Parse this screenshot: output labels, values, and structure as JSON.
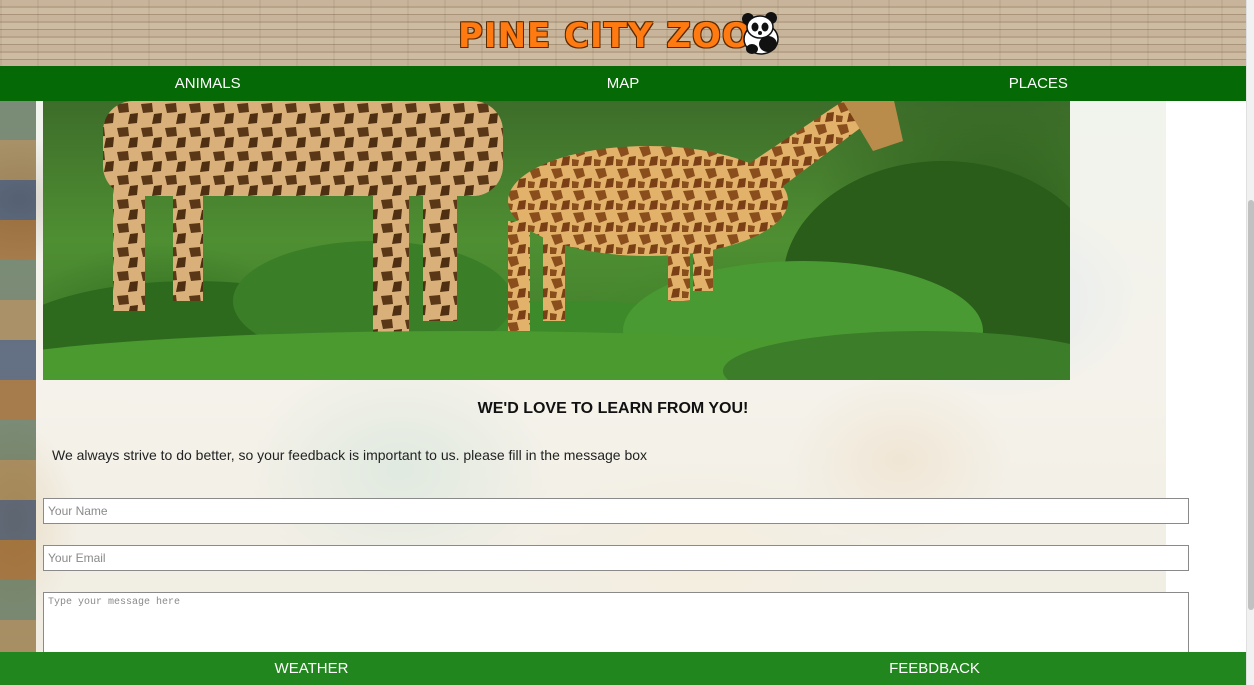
{
  "brand": {
    "logo_text": "PINE CITY ZOO"
  },
  "topnav": {
    "items": [
      {
        "label": "ANIMALS"
      },
      {
        "label": "MAP"
      },
      {
        "label": "PLACES"
      }
    ]
  },
  "main": {
    "heading": "WE'D LOVE TO LEARN FROM YOU!",
    "intro": "We always strive to do better, so your feedback is important to us. please fill in the message box"
  },
  "form": {
    "name_placeholder": "Your Name",
    "email_placeholder": "Your Email",
    "message_placeholder": "Type your message here"
  },
  "bottomnav": {
    "items": [
      {
        "label": "WEATHER"
      },
      {
        "label": "FEEBDBACK"
      }
    ]
  },
  "colors": {
    "nav_green": "#056905",
    "footer_green": "#22861f",
    "logo_orange": "#ff7a10"
  }
}
